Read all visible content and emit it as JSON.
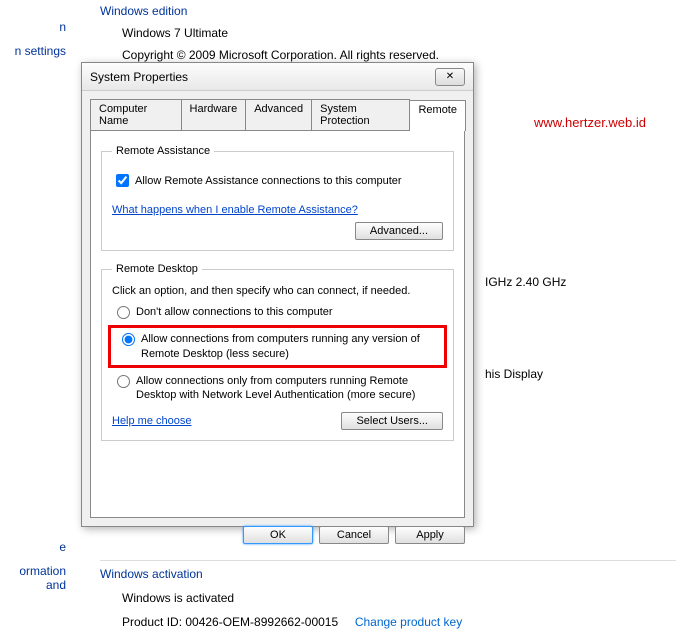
{
  "left_nav": {
    "item1": "n",
    "item2": "n settings"
  },
  "edition": {
    "heading": "Windows edition",
    "name": "Windows 7 Ultimate",
    "copyright": "Copyright © 2009 Microsoft Corporation.  All rights reserved."
  },
  "url_watermark": "www.hertzer.web.id",
  "bg_cpu": "IGHz  2.40 GHz",
  "bg_display": "his Display",
  "dialog": {
    "title": "System Properties",
    "tabs": {
      "t1": "Computer Name",
      "t2": "Hardware",
      "t3": "Advanced",
      "t4": "System Protection",
      "t5": "Remote"
    },
    "ra": {
      "legend": "Remote Assistance",
      "checkbox": "Allow Remote Assistance connections to this computer",
      "link": "What happens when I enable Remote Assistance?",
      "advanced_btn": "Advanced..."
    },
    "rd": {
      "legend": "Remote Desktop",
      "intro": "Click an option, and then specify who can connect, if needed.",
      "opt1": "Don't allow connections to this computer",
      "opt2": "Allow connections from computers running any version of Remote Desktop (less secure)",
      "opt3": "Allow connections only from computers running Remote Desktop with Network Level Authentication (more secure)",
      "help_link": "Help me choose",
      "select_users_btn": "Select Users..."
    },
    "buttons": {
      "ok": "OK",
      "cancel": "Cancel",
      "apply": "Apply"
    }
  },
  "activation": {
    "see_also_e": "e",
    "see_also_info": "ormation and",
    "heading": "Windows activation",
    "status": "Windows is activated",
    "pid_label": "Product ID: 00426-OEM-8992662-00015",
    "change_link": "Change product key"
  }
}
